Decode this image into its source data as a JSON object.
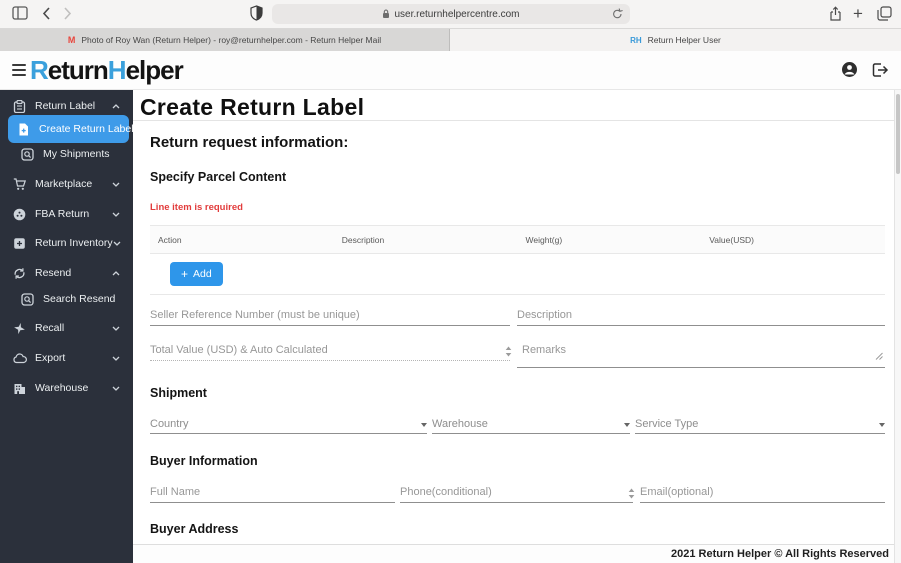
{
  "browser": {
    "url": "user.returnhelpercentre.com",
    "tabs": [
      {
        "label": "Photo of Roy Wan (Return Helper) - roy@returnhelper.com - Return Helper Mail",
        "favicon": "gmail-icon",
        "active": false
      },
      {
        "label": "Return Helper User",
        "favicon": "return-helper-icon",
        "active": true
      }
    ]
  },
  "header": {
    "logo_r": "R",
    "logo_eturn": "eturn",
    "logo_h": "H",
    "logo_elper": "elper"
  },
  "sidebar": {
    "items": [
      {
        "label": "Return Label",
        "icon": "clipboard-icon",
        "chevron": "up",
        "level": "top"
      },
      {
        "label": "Create Return Label",
        "icon": "file-plus-icon",
        "level": "sub",
        "active": true
      },
      {
        "label": "My Shipments",
        "icon": "search-box-icon",
        "level": "sub"
      },
      {
        "label": "Marketplace",
        "icon": "cart-icon",
        "chevron": "down",
        "level": "top"
      },
      {
        "label": "FBA Return",
        "icon": "fba-circle-icon",
        "chevron": "down",
        "level": "top"
      },
      {
        "label": "Return Inventory",
        "icon": "box-plus-icon",
        "chevron": "down",
        "level": "top"
      },
      {
        "label": "Resend",
        "icon": "refresh-icon",
        "chevron": "up",
        "level": "top"
      },
      {
        "label": "Search Resend",
        "icon": "search-box-icon",
        "level": "sub"
      },
      {
        "label": "Recall",
        "icon": "plane-icon",
        "chevron": "down",
        "level": "top"
      },
      {
        "label": "Export",
        "icon": "cloud-icon",
        "chevron": "down",
        "level": "top"
      },
      {
        "label": "Warehouse",
        "icon": "warehouse-icon",
        "chevron": "down",
        "level": "top"
      }
    ]
  },
  "main": {
    "page_title": "Create Return Label",
    "request_info_heading": "Return request information:",
    "parcel": {
      "heading": "Specify Parcel Content",
      "error": "Line item is required",
      "columns": [
        "Action",
        "Description",
        "Weight(g)",
        "Value(USD)"
      ],
      "add_button": "Add"
    },
    "fields": {
      "seller_ref": "Seller Reference Number (must be unique)",
      "description": "Description",
      "total_value": "Total Value (USD) & Auto Calculated",
      "remarks": "Remarks"
    },
    "shipment": {
      "heading": "Shipment",
      "country": "Country",
      "warehouse": "Warehouse",
      "service_type": "Service Type"
    },
    "buyer": {
      "heading": "Buyer Information",
      "full_name": "Full Name",
      "phone": "Phone(conditional)",
      "email": "Email(optional)"
    },
    "buyer_address_heading": "Buyer Address"
  },
  "footer": {
    "text": "2021 Return Helper © All Rights Reserved"
  },
  "colors": {
    "accent_blue": "#3e9be9",
    "sidebar_bg": "#2b303b",
    "error_red": "#e23c3c",
    "add_button_blue": "#2e96ea",
    "logo_blue": "#3aa0dc"
  }
}
